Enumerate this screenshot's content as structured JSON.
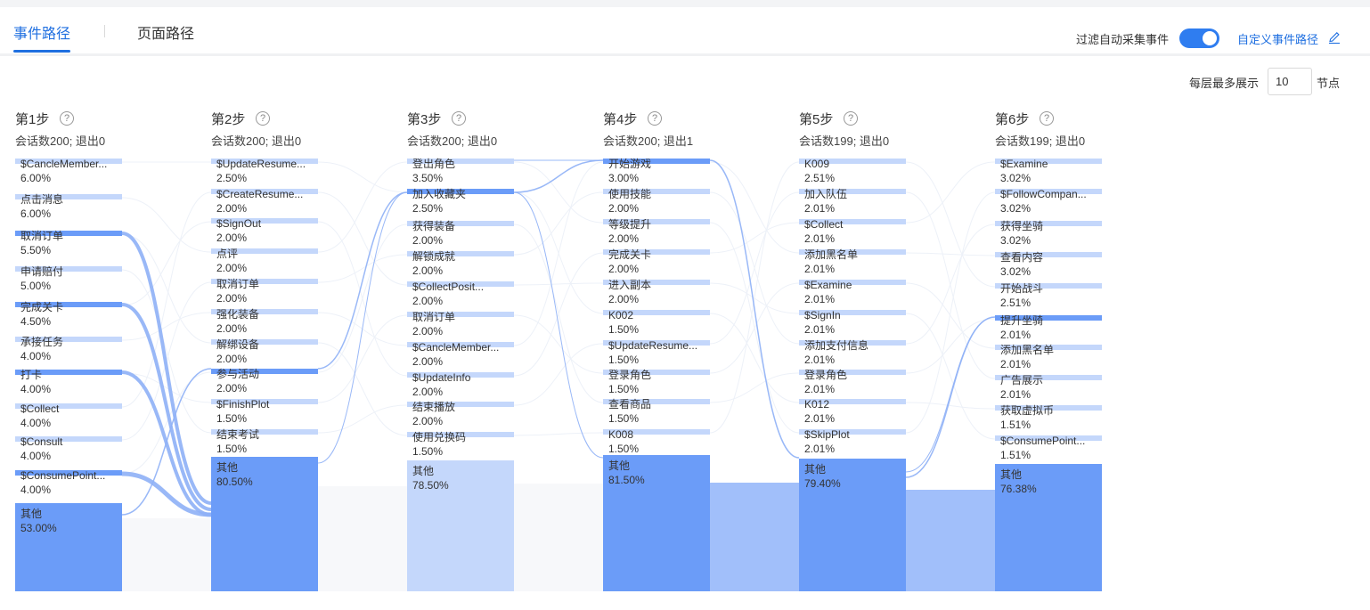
{
  "tabs": [
    {
      "label": "事件路径",
      "active": true
    },
    {
      "label": "页面路径",
      "active": false
    }
  ],
  "toolbar": {
    "filter_label": "过滤自动采集事件",
    "filter_enabled": true,
    "custom_path_label": "自定义事件路径",
    "max_label": "每层最多展示",
    "max_value": "10",
    "max_unit": "节点"
  },
  "colors": {
    "primary": "#1f6fe0",
    "node": "#c4d7fb",
    "node_active": "#6b9cf8",
    "other": "#6b9cf8",
    "other_light": "#c4d7fb"
  },
  "steps": [
    {
      "title": "第1步",
      "subtitle": "会话数200; 退出0",
      "nodes": [
        {
          "name": "$CancleMember...",
          "pct": "6.00%"
        },
        {
          "name": "点击消息",
          "pct": "6.00%"
        },
        {
          "name": "取消订单",
          "pct": "5.50%",
          "active": true
        },
        {
          "name": "申请赔付",
          "pct": "5.00%"
        },
        {
          "name": "完成关卡",
          "pct": "4.50%",
          "active": true
        },
        {
          "name": "承接任务",
          "pct": "4.00%"
        },
        {
          "name": "打卡",
          "pct": "4.00%",
          "active": true
        },
        {
          "name": "$Collect",
          "pct": "4.00%"
        },
        {
          "name": "$Consult",
          "pct": "4.00%"
        },
        {
          "name": "$ConsumePoint...",
          "pct": "4.00%",
          "active": true
        }
      ],
      "other": {
        "name": "其他",
        "pct": "53.00%"
      }
    },
    {
      "title": "第2步",
      "subtitle": "会话数200; 退出0",
      "nodes": [
        {
          "name": "$UpdateResume...",
          "pct": "2.50%"
        },
        {
          "name": "$CreateResume...",
          "pct": "2.00%"
        },
        {
          "name": "$SignOut",
          "pct": "2.00%"
        },
        {
          "name": "点评",
          "pct": "2.00%"
        },
        {
          "name": "取消订单",
          "pct": "2.00%"
        },
        {
          "name": "强化装备",
          "pct": "2.00%"
        },
        {
          "name": "解绑设备",
          "pct": "2.00%"
        },
        {
          "name": "参与活动",
          "pct": "2.00%",
          "active": true
        },
        {
          "name": "$FinishPlot",
          "pct": "1.50%"
        },
        {
          "name": "结束考试",
          "pct": "1.50%"
        }
      ],
      "other": {
        "name": "其他",
        "pct": "80.50%"
      }
    },
    {
      "title": "第3步",
      "subtitle": "会话数200; 退出0",
      "nodes": [
        {
          "name": "登出角色",
          "pct": "3.50%"
        },
        {
          "name": "加入收藏夹",
          "pct": "2.50%",
          "active": true
        },
        {
          "name": "获得装备",
          "pct": "2.00%"
        },
        {
          "name": "解锁成就",
          "pct": "2.00%"
        },
        {
          "name": "$CollectPosit...",
          "pct": "2.00%"
        },
        {
          "name": "取消订单",
          "pct": "2.00%"
        },
        {
          "name": "$CancleMember...",
          "pct": "2.00%"
        },
        {
          "name": "$UpdateInfo",
          "pct": "2.00%"
        },
        {
          "name": "结束播放",
          "pct": "2.00%"
        },
        {
          "name": "使用兑换码",
          "pct": "1.50%"
        }
      ],
      "other": {
        "name": "其他",
        "pct": "78.50%",
        "light": true
      }
    },
    {
      "title": "第4步",
      "subtitle": "会话数200; 退出1",
      "nodes": [
        {
          "name": "开始游戏",
          "pct": "3.00%",
          "active": true
        },
        {
          "name": "使用技能",
          "pct": "2.00%"
        },
        {
          "name": "等级提升",
          "pct": "2.00%"
        },
        {
          "name": "完成关卡",
          "pct": "2.00%"
        },
        {
          "name": "进入副本",
          "pct": "2.00%"
        },
        {
          "name": "K002",
          "pct": "1.50%"
        },
        {
          "name": "$UpdateResume...",
          "pct": "1.50%"
        },
        {
          "name": "登录角色",
          "pct": "1.50%"
        },
        {
          "name": "查看商品",
          "pct": "1.50%"
        },
        {
          "name": "K008",
          "pct": "1.50%"
        }
      ],
      "other": {
        "name": "其他",
        "pct": "81.50%"
      }
    },
    {
      "title": "第5步",
      "subtitle": "会话数199; 退出0",
      "nodes": [
        {
          "name": "K009",
          "pct": "2.51%"
        },
        {
          "name": "加入队伍",
          "pct": "2.01%"
        },
        {
          "name": "$Collect",
          "pct": "2.01%"
        },
        {
          "name": "添加黑名单",
          "pct": "2.01%"
        },
        {
          "name": "$Examine",
          "pct": "2.01%"
        },
        {
          "name": "$SignIn",
          "pct": "2.01%"
        },
        {
          "name": "添加支付信息",
          "pct": "2.01%"
        },
        {
          "name": "登录角色",
          "pct": "2.01%"
        },
        {
          "name": "K012",
          "pct": "2.01%"
        },
        {
          "name": "$SkipPlot",
          "pct": "2.01%"
        }
      ],
      "other": {
        "name": "其他",
        "pct": "79.40%"
      }
    },
    {
      "title": "第6步",
      "subtitle": "会话数199; 退出0",
      "nodes": [
        {
          "name": "$Examine",
          "pct": "3.02%"
        },
        {
          "name": "$FollowCompan...",
          "pct": "3.02%"
        },
        {
          "name": "获得坐骑",
          "pct": "3.02%"
        },
        {
          "name": "查看内容",
          "pct": "3.02%"
        },
        {
          "name": "开始战斗",
          "pct": "2.51%"
        },
        {
          "name": "提升坐骑",
          "pct": "2.01%",
          "active": true
        },
        {
          "name": "添加黑名单",
          "pct": "2.01%"
        },
        {
          "name": "广告展示",
          "pct": "2.01%"
        },
        {
          "name": "获取虚拟币",
          "pct": "1.51%"
        },
        {
          "name": "$ConsumePoint...",
          "pct": "1.51%"
        }
      ],
      "other": {
        "name": "其他",
        "pct": "76.38%"
      }
    }
  ]
}
